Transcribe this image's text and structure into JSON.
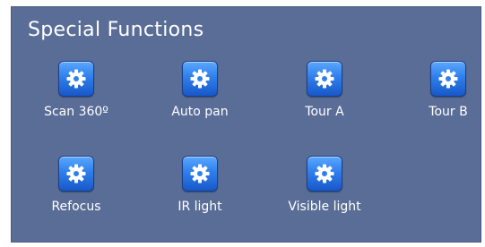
{
  "panel": {
    "title": "Special Functions",
    "buttons": [
      {
        "label": "Scan 360º",
        "icon": "gear-icon"
      },
      {
        "label": "Auto pan",
        "icon": "gear-icon"
      },
      {
        "label": "Tour A",
        "icon": "gear-icon"
      },
      {
        "label": "Tour B",
        "icon": "gear-icon"
      },
      {
        "label": "Refocus",
        "icon": "gear-icon"
      },
      {
        "label": "IR light",
        "icon": "gear-icon"
      },
      {
        "label": "Visible light",
        "icon": "gear-icon"
      }
    ]
  },
  "colors": {
    "panel_bg": "#5a6d97",
    "button_blue": "#2f7fec",
    "text": "#ffffff"
  }
}
